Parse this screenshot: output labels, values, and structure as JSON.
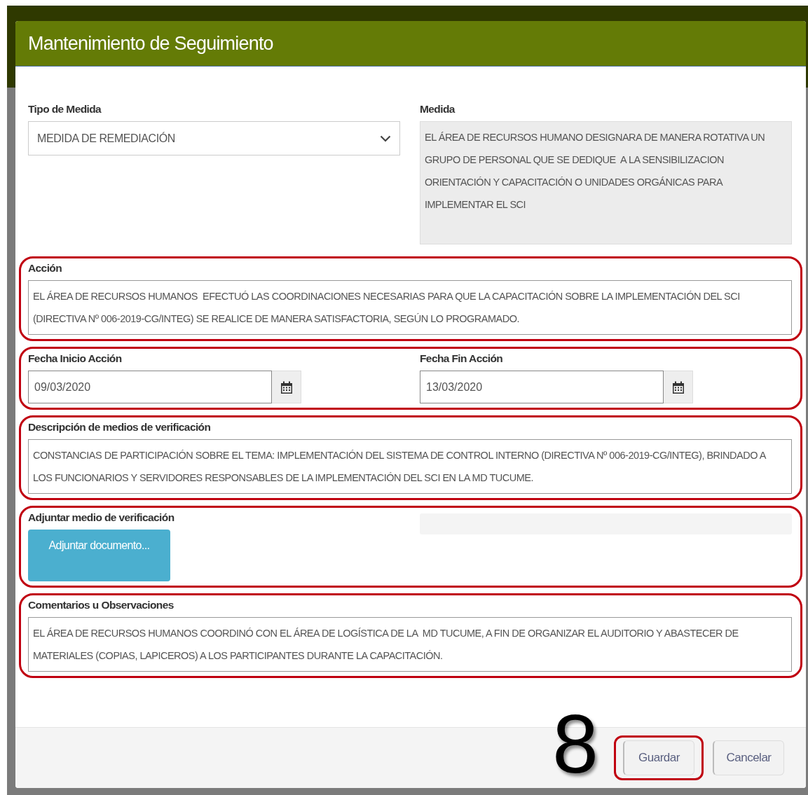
{
  "dialog": {
    "title": "Mantenimiento de Seguimiento"
  },
  "sections": [
    {
      "highlighted": false,
      "fields": [
        {
          "kind": "select",
          "label": "Tipo de Medida",
          "value": "MEDIDA DE REMEDIACIÓN"
        },
        {
          "kind": "textarea",
          "label": "Medida",
          "disabled": true,
          "value": "EL ÁREA DE RECURSOS HUMANO DESIGNARA DE MANERA ROTATIVA UN GRUPO DE PERSONAL QUE SE DEDIQUE  A LA SENSIBILIZACION ORIENTACIÓN Y CAPACITACIÓN O UNIDADES ORGÁNICAS PARA IMPLEMENTAR EL SCI"
        }
      ]
    },
    {
      "highlighted": true,
      "fields": [
        {
          "kind": "textarea",
          "label": "Acción",
          "disabled": false,
          "value": "EL ÁREA DE RECURSOS HUMANOS  EFECTUÓ LAS COORDINACIONES NECESARIAS PARA QUE LA CAPACITACIÓN SOBRE LA IMPLEMENTACIÓN DEL SCI (DIRECTIVA Nº 006-2019-CG/INTEG) SE REALICE DE MANERA SATISFACTORIA, SEGÚN LO PROGRAMADO."
        }
      ]
    },
    {
      "highlighted": true,
      "fields": [
        {
          "kind": "date",
          "label": "Fecha Inicio Acción",
          "value": "09/03/2020"
        },
        {
          "kind": "date",
          "label": "Fecha Fin Acción",
          "value": "13/03/2020"
        }
      ]
    },
    {
      "highlighted": true,
      "fields": [
        {
          "kind": "textarea",
          "label": "Descripción de medios de verificación",
          "disabled": false,
          "value": "CONSTANCIAS DE PARTICIPACIÓN SOBRE EL TEMA: IMPLEMENTACIÓN DEL SISTEMA DE CONTROL INTERNO (DIRECTIVA Nº 006-2019-CG/INTEG), BRINDADO A LOS FUNCIONARIOS Y SERVIDORES RESPONSABLES DE LA IMPLEMENTACIÓN DEL SCI EN LA MD TUCUME."
        }
      ]
    },
    {
      "highlighted": true,
      "fields": [
        {
          "kind": "upload",
          "label": "Adjuntar medio de verificación",
          "button": "Adjuntar documento..."
        },
        {
          "kind": "file_name"
        }
      ]
    },
    {
      "highlighted": true,
      "fields": [
        {
          "kind": "textarea",
          "label": "Comentarios u Observaciones",
          "disabled": false,
          "value": "EL ÁREA DE RECURSOS HUMANOS COORDINÓ CON EL ÁREA DE LOGÍSTICA DE LA  MD TUCUME, A FIN DE ORGANIZAR EL AUDITORIO Y ABASTECER DE MATERIALES (COPIAS, LAPICEROS) A LOS PARTICIPANTES DURANTE LA CAPACITACIÓN."
        }
      ]
    }
  ],
  "step_number": "8",
  "actions": [
    {
      "label": "Guardar",
      "highlighted": true
    },
    {
      "label": "Cancelar",
      "highlighted": false
    }
  ]
}
